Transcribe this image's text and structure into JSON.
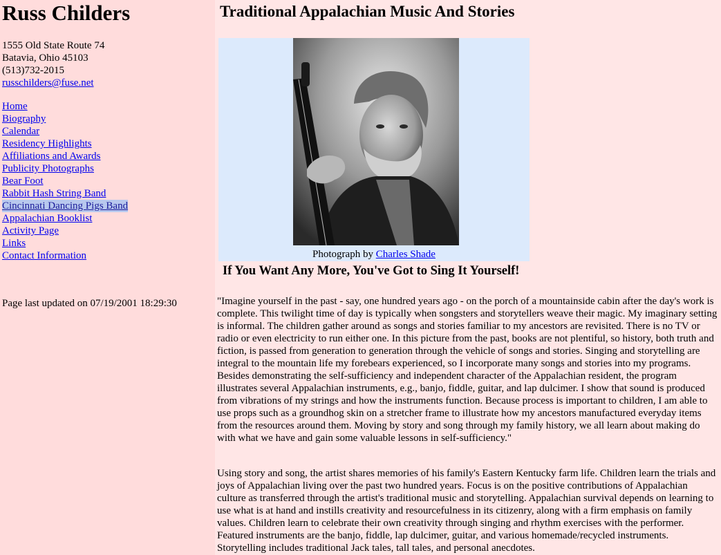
{
  "sidebar": {
    "name": "Russ Childers",
    "address_line1": "1555 Old State Route 74",
    "address_line2": "Batavia, Ohio 45103",
    "phone": "(513)732-2015",
    "email": "russchilders@fuse.net",
    "nav": [
      {
        "label": "Home"
      },
      {
        "label": "Biography"
      },
      {
        "label": "Calendar"
      },
      {
        "label": "Residency Highlights"
      },
      {
        "label": "Affiliations and Awards"
      },
      {
        "label": "Publicity Photographs"
      },
      {
        "label": "Bear Foot"
      },
      {
        "label": "Rabbit Hash String Band"
      },
      {
        "label": "Cincinnati Dancing Pigs Band",
        "selected": true
      },
      {
        "label": "Appalachian Booklist"
      },
      {
        "label": "Activity Page"
      },
      {
        "label": "Links"
      },
      {
        "label": "Contact Information"
      }
    ],
    "last_updated": "Page last updated on 07/19/2001 18:29:30"
  },
  "main": {
    "title": "Traditional Appalachian Music And Stories",
    "photo_caption_prefix": "Photograph by ",
    "photo_caption_link": "Charles Shade",
    "tagline": "If You Want Any More, You've Got to Sing It Yourself!",
    "paragraph1": "\"Imagine yourself in the past - say, one hundred years ago - on the porch of a mountainside cabin after the day's work is complete. This twilight time of day is typically when songsters and storytellers weave their magic. My imaginary setting is informal. The children gather around as songs and stories familiar to my ancestors are revisited. There is no TV or radio or even electricity to run either one. In this picture from the past, books are not plentiful, so history, both truth and fiction, is passed from generation to generation through the vehicle of songs and stories. Singing and storytelling are integral to the mountain life my forebears experienced, so I incorporate many songs and stories into my programs. Besides demonstrating the self-sufficiency and independent character of the Appalachian resident, the program illustrates several Appalachian instruments, e.g., banjo, fiddle, guitar, and lap dulcimer. I show that sound is produced from vibrations of my strings and how the instruments function. Because process is important to children, I am able to use props such as a groundhog skin on a stretcher frame to illustrate how my ancestors manufactured everyday items from the resources around them. Moving by story and song through my family history, we all learn about making do with what we have and gain some valuable lessons in self-sufficiency.\"",
    "paragraph2": "Using story and song, the artist shares memories of his family's Eastern Kentucky farm life. Children learn the trials and joys of Appalachian living over the past two hundred years. Focus is on the positive contributions of Appalachian culture as transferred through the artist's traditional music and storytelling. Appalachian survival depends on learning to use what is at hand and instills creativity and resourcefulness in its citizenry, along with a firm emphasis on family values. Children learn to celebrate their own creativity through singing and rhythm exercises with the performer. Featured instruments are the banjo, fiddle, lap dulcimer, guitar, and various homemade/recycled instruments. Storytelling includes traditional Jack tales, tall tales, and personal anecdotes."
  },
  "colors": {
    "sidebar_bg": "#ffdcdc",
    "main_bg": "#ffe6e6",
    "photo_box_bg": "#dceafc",
    "link": "#0000ee",
    "selected_highlight": "#b8c8ee"
  }
}
